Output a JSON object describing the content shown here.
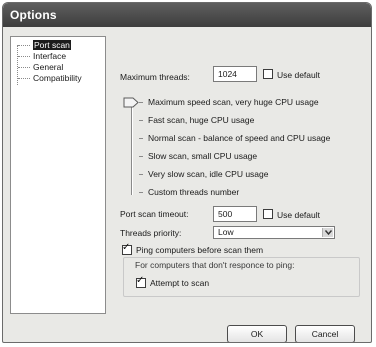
{
  "window": {
    "title": "Options"
  },
  "tree": {
    "items": [
      {
        "label": "Port scan",
        "selected": true
      },
      {
        "label": "Interface",
        "selected": false
      },
      {
        "label": "General",
        "selected": false
      },
      {
        "label": "Compatibility",
        "selected": false
      }
    ]
  },
  "threads": {
    "label": "Maximum threads:",
    "value": "1024",
    "use_default_label": "Use default",
    "use_default_checked": false
  },
  "speed": {
    "options": [
      "Maximum speed scan, very huge CPU usage",
      "Fast scan, huge CPU usage",
      "Normal scan - balance of speed and CPU usage",
      "Slow scan, small CPU usage",
      "Very slow scan, idle CPU usage",
      "Custom threads number"
    ],
    "selected_index": 0
  },
  "timeout": {
    "label": "Port scan timeout:",
    "value": "500",
    "use_default_label": "Use default",
    "use_default_checked": false
  },
  "priority": {
    "label": "Threads priority:",
    "value": "Low"
  },
  "ping": {
    "label": "Ping computers before scan them",
    "checked": true,
    "group_label": "For computers that don't responce to ping:",
    "attempt_label": "Attempt to scan",
    "attempt_checked": true
  },
  "buttons": {
    "ok": "OK",
    "cancel": "Cancel"
  }
}
